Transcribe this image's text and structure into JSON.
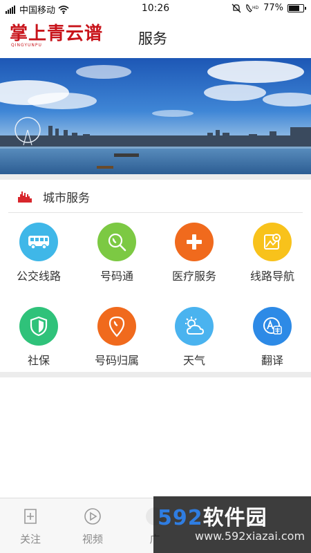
{
  "status_bar": {
    "carrier": "中国移动",
    "time": "10:26",
    "battery": "77%",
    "battery_level": 0.77
  },
  "header": {
    "logo_text": "掌上青云谱",
    "logo_sub": "QINGYUNPU",
    "title": "服务"
  },
  "section": {
    "title": "城市服务",
    "icon": "city-skyline-icon"
  },
  "services": [
    {
      "label": "公交线路",
      "icon": "bus-icon",
      "color": "#3fb7e8"
    },
    {
      "label": "号码通",
      "icon": "phone-search-icon",
      "color": "#7cc943"
    },
    {
      "label": "医疗服务",
      "icon": "medical-cross-icon",
      "color": "#f06a1d"
    },
    {
      "label": "线路导航",
      "icon": "map-navigation-icon",
      "color": "#f8c21b"
    },
    {
      "label": "社保",
      "icon": "shield-icon",
      "color": "#2fc27a"
    },
    {
      "label": "号码归属",
      "icon": "phone-location-icon",
      "color": "#f06a1d"
    },
    {
      "label": "天气",
      "icon": "weather-icon",
      "color": "#4ab3ef"
    },
    {
      "label": "翻译",
      "icon": "translate-icon",
      "color": "#2d8ae6"
    }
  ],
  "bottom_nav": [
    {
      "label": "关注",
      "icon": "add-follow-icon"
    },
    {
      "label": "视频",
      "icon": "play-icon"
    },
    {
      "label": "广",
      "icon": "tab-icon"
    }
  ],
  "watermark": {
    "brand_num": "592",
    "brand_text": "软件园",
    "url": "www.592xiazai.com"
  },
  "colors": {
    "brand_red": "#c8141b",
    "separator": "#ececec"
  }
}
